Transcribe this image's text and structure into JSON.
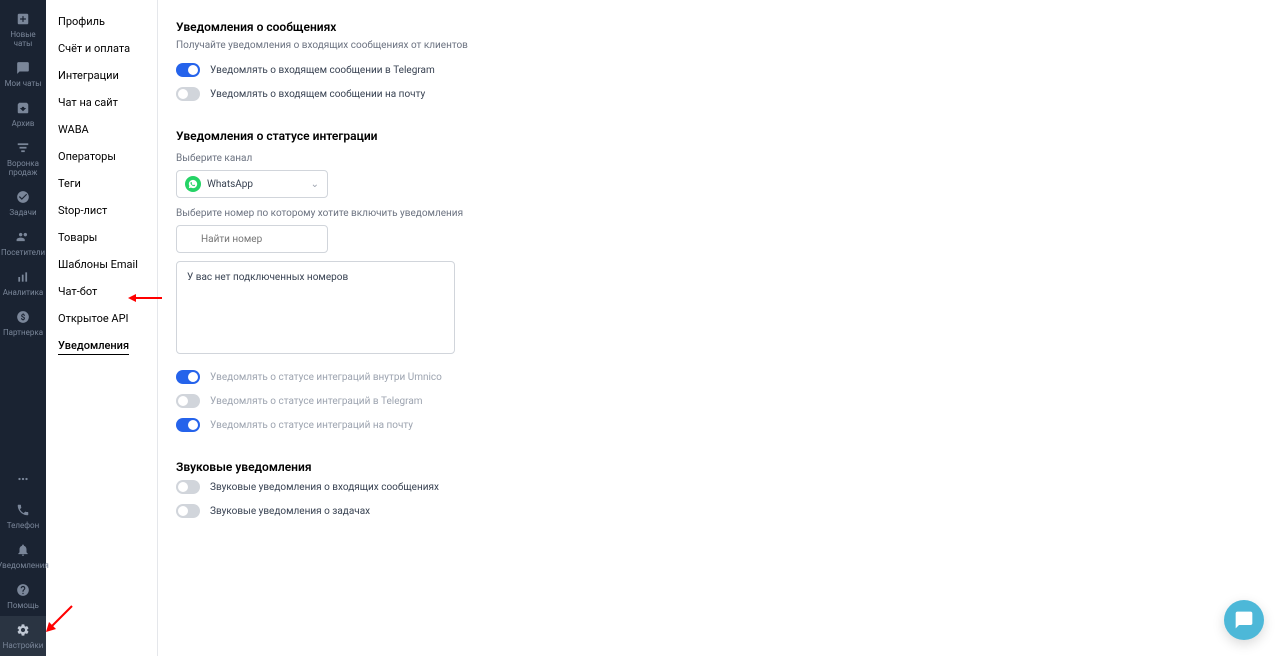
{
  "leftNav": {
    "top": [
      {
        "label": "Новые чаты",
        "icon": "plus-box"
      },
      {
        "label": "Мои чаты",
        "icon": "chat"
      },
      {
        "label": "Архив",
        "icon": "archive"
      },
      {
        "label": "Воронка продаж",
        "icon": "funnel"
      },
      {
        "label": "Задачи",
        "icon": "check"
      },
      {
        "label": "Посетители",
        "icon": "users"
      },
      {
        "label": "Аналитика",
        "icon": "bars"
      },
      {
        "label": "Партнерка",
        "icon": "dollar"
      }
    ],
    "bottom": [
      {
        "label": "",
        "icon": "dots"
      },
      {
        "label": "Телефон",
        "icon": "phone"
      },
      {
        "label": "Уведомления",
        "icon": "bell"
      },
      {
        "label": "Помощь",
        "icon": "help"
      },
      {
        "label": "Настройки",
        "icon": "gear",
        "active": true
      }
    ]
  },
  "settingsMenu": [
    "Профиль",
    "Счёт и оплата",
    "Интеграции",
    "Чат на сайт",
    "WABA",
    "Операторы",
    "Теги",
    "Stop-лист",
    "Товары",
    "Шаблоны Email",
    "Чат-бот",
    "Открытое API",
    "Уведомления"
  ],
  "settingsActiveIndex": 12,
  "section1": {
    "title": "Уведомления о сообщениях",
    "desc": "Получайте уведомления о входящих сообщениях от клиентов",
    "toggles": [
      {
        "label": "Уведомлять о входящем сообщении в Telegram",
        "on": true
      },
      {
        "label": "Уведомлять о входящем сообщении на почту",
        "on": false
      }
    ]
  },
  "section2": {
    "title": "Уведомления о статусе интеграции",
    "channelLabel": "Выберите канал",
    "channelValue": "WhatsApp",
    "numberLabel": "Выберите номер по которому хотите включить уведомления",
    "searchPlaceholder": "Найти номер",
    "emptyNumbers": "У вас нет подключенных номеров",
    "toggles": [
      {
        "label": "Уведомлять о статусе интеграций внутри Umnico",
        "on": true,
        "muted": true
      },
      {
        "label": "Уведомлять о статусе интеграций в Telegram",
        "on": false,
        "muted": true
      },
      {
        "label": "Уведомлять о статусе интеграций на почту",
        "on": true,
        "muted": true
      }
    ]
  },
  "section3": {
    "title": "Звуковые уведомления",
    "toggles": [
      {
        "label": "Звуковые уведомления о входящих сообщениях",
        "on": false
      },
      {
        "label": "Звуковые уведомления о задачах",
        "on": false
      }
    ]
  }
}
